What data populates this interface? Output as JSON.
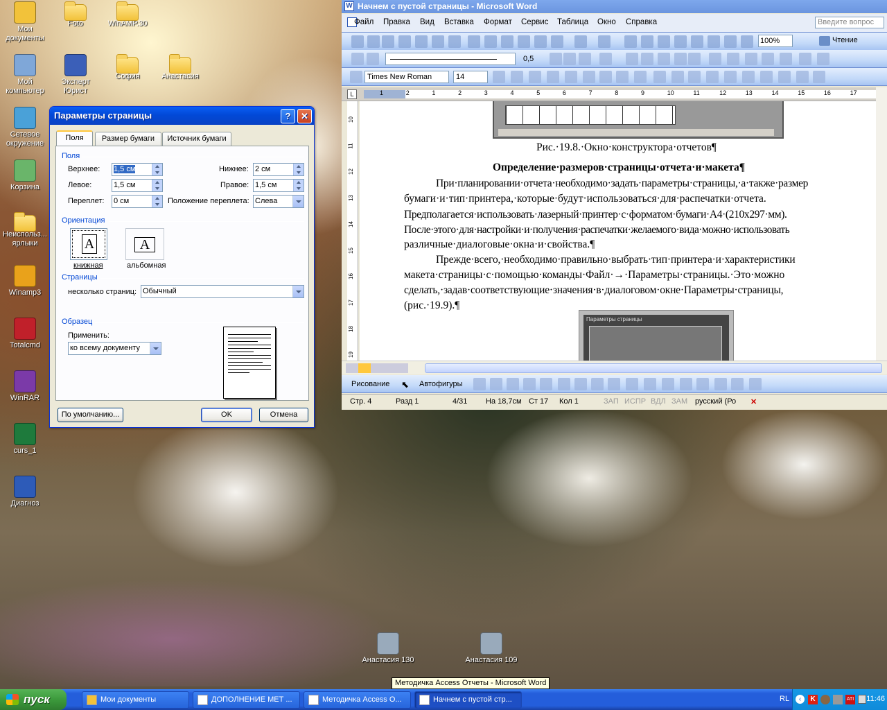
{
  "desktop": {
    "icons": [
      {
        "label": "Мои документы",
        "icon": "my-documents-icon"
      },
      {
        "label": "Foto",
        "icon": "folder-icon"
      },
      {
        "label": "WinAMP.30",
        "icon": "folder-icon"
      },
      {
        "label": "Мой компьютер",
        "icon": "my-computer-icon"
      },
      {
        "label": "Эксперт Юрист",
        "icon": "app-icon"
      },
      {
        "label": "София",
        "icon": "folder-icon"
      },
      {
        "label": "Анастасия",
        "icon": "folder-icon"
      },
      {
        "label": "Сетевое окружение",
        "icon": "network-icon"
      },
      {
        "label": "Корзина",
        "icon": "recycle-bin-icon"
      },
      {
        "label": "Неиспольз... ярлыки",
        "icon": "folder-icon"
      },
      {
        "label": "Winamp3",
        "icon": "winamp-icon"
      },
      {
        "label": "Totalcmd",
        "icon": "totalcmd-icon"
      },
      {
        "label": "WinRAR",
        "icon": "winrar-icon"
      },
      {
        "label": "curs_1",
        "icon": "excel-file-icon"
      },
      {
        "label": "Диагноз",
        "icon": "word-file-icon"
      },
      {
        "label": "Анастасия 130",
        "icon": "jpg-file-icon"
      },
      {
        "label": "Анастасия 109",
        "icon": "jpg-file-icon"
      }
    ],
    "tooltip": "Методичка Access Отчеты - Microsoft Word"
  },
  "dialog": {
    "title": "Параметры страницы",
    "tabs": [
      "Поля",
      "Размер бумаги",
      "Источник бумаги"
    ],
    "fields_group": "Поля",
    "top_label": "Верхнее:",
    "top_value": "1,5 см",
    "bottom_label": "Нижнее:",
    "bottom_value": "2 см",
    "left_label": "Левое:",
    "left_value": "1,5 см",
    "right_label": "Правое:",
    "right_value": "1,5 см",
    "gutter_label": "Переплет:",
    "gutter_value": "0 см",
    "gutter_pos_label": "Положение переплета:",
    "gutter_pos_value": "Слева",
    "orientation_group": "Ориентация",
    "portrait": "книжная",
    "landscape": "альбомная",
    "pages_group": "Страницы",
    "multiple_label": "несколько страниц:",
    "multiple_value": "Обычный",
    "sample_group": "Образец",
    "apply_label": "Применить:",
    "apply_value": "ко всему документу",
    "default_btn": "По умолчанию...",
    "ok_btn": "OK",
    "cancel_btn": "Отмена"
  },
  "word": {
    "title": "Начнем с пустой страницы - Microsoft Word",
    "menu": [
      "Файл",
      "Правка",
      "Вид",
      "Вставка",
      "Формат",
      "Сервис",
      "Таблица",
      "Окно",
      "Справка"
    ],
    "help_box": "Введите вопрос",
    "zoom": "100%",
    "reading": "Чтение",
    "line_weight": "0,5",
    "font": "Times New Roman",
    "font_size": "14",
    "ruler_marks": [
      "1",
      "2",
      "1",
      "2",
      "3",
      "4",
      "5",
      "6",
      "7",
      "8",
      "9",
      "10",
      "11",
      "12",
      "13",
      "14",
      "15",
      "16",
      "17"
    ],
    "vruler_marks": [
      "10",
      "11",
      "12",
      "13",
      "14",
      "15",
      "16",
      "17",
      "18",
      "19"
    ],
    "doc": {
      "caption": "Рис.·19.8.·Окно·конструктора·отчетов¶",
      "heading": "Определение·размеров·страницы·отчета·и·макета¶",
      "lines": [
        "При·планировании·отчета·необходимо·задать·параметры·страницы,·а·также·размер",
        "бумаги·и·тип·принтера,·которые·будут·использоваться·для·распечатки·отчета.",
        "Предполагается·использовать·лазерный·принтер·с·форматом·бумаги·А4·(210х297·мм).",
        "После·этого·для·настройки·и·получения·распечатки·желаемого·вида·можно·использовать",
        "различные·диалоговые·окна·и·свойства.¶",
        "Прежде·всего,·необходимо·правильно·выбрать·тип·принтера·и·характеристики",
        "макета·страницы·с·помощью·команды·Файл·→·Параметры·страницы.·Это·можно",
        "сделать,·задав·соответствующие·значения·в·диалоговом·окне·Параметры·страницы,",
        "(рис.·19.9).¶"
      ],
      "thumb_title": "Параметры страницы"
    },
    "drawing_label": "Рисование",
    "autoshapes": "Автофигуры",
    "status": [
      "Стр.  4",
      "Разд  1",
      "4/31",
      "На 18,7см",
      "Ст  17",
      "Кол  1",
      "ЗАП",
      "ИСПР",
      "ВДЛ",
      "ЗАМ",
      "русский (Ро"
    ]
  },
  "taskbar": {
    "start": "пуск",
    "tasks": [
      "Мои документы",
      "ДОПОЛНЕНИЕ МЕТ ...",
      "Методичка Access О...",
      "Начнем с пустой стр..."
    ],
    "lang": "RL",
    "clock": "11:46"
  },
  "colors": {
    "xp_blue": "#0249d7",
    "taskbar": "#245edb",
    "start": "#3c9a3c"
  }
}
